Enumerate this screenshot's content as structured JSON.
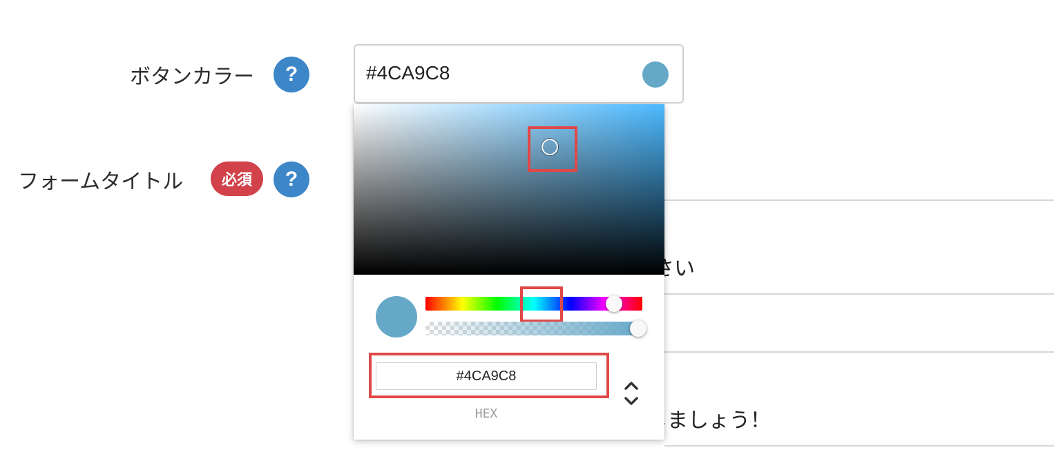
{
  "button_color": {
    "label": "ボタンカラー",
    "help": "?",
    "value": "#4CA9C8",
    "swatch_color": "#66a8c8"
  },
  "form_title": {
    "label": "フォームタイトル",
    "required_badge": "必須",
    "help": "?"
  },
  "background_fragments": [
    "さい",
    "しましょう！"
  ],
  "picker": {
    "hue_color": "#4bb9ff",
    "preview_color": "#66a8c8",
    "hex_value": "#4CA9C8",
    "mode_label": "HEX",
    "alpha": 1.0,
    "highlight_color": "#e04848"
  }
}
